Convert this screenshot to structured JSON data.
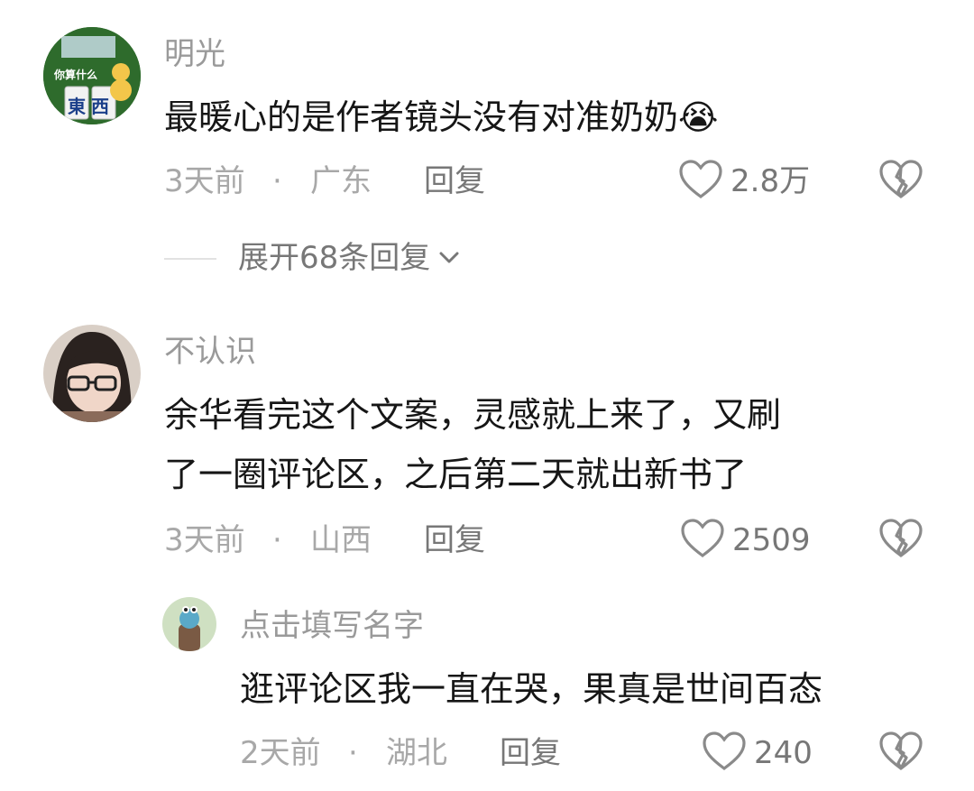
{
  "comments": [
    {
      "user": "明光",
      "text_lines": [
        "最暖心的是作者镜头没有对准奶奶😭"
      ],
      "time": "3天前",
      "sep": "·",
      "location": "广东",
      "reply_label": "回复",
      "likes": "2.8万",
      "avatar_badge_text": "你算什么",
      "avatar_tiles": "東西"
    },
    {
      "user": "不认识",
      "text_lines": [
        "余华看完这个文案，灵感就上来了，又刷",
        "了一圈评论区，之后第二天就出新书了"
      ],
      "time": "3天前",
      "sep": "·",
      "location": "山西",
      "reply_label": "回复",
      "likes": "2509"
    }
  ],
  "expand_replies": "展开68条回复",
  "reply": {
    "user": "点击填写名字",
    "text": "逛评论区我一直在哭，果真是世间百态",
    "time": "2天前",
    "sep": "·",
    "location": "湖北",
    "reply_label": "回复",
    "likes": "240"
  },
  "colors": {
    "username": "#9a9a9a",
    "text": "#161616",
    "meta": "#a8a8a8",
    "action": "#777777"
  }
}
